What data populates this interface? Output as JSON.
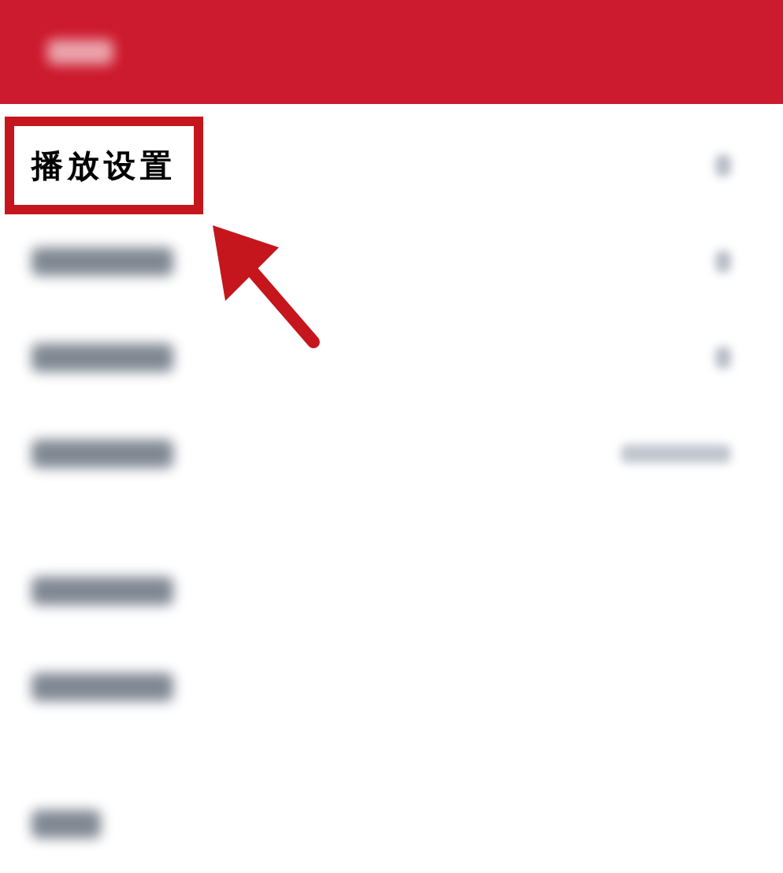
{
  "header": {
    "title_blurred": true
  },
  "groups": [
    {
      "items": [
        {
          "kind": "text",
          "label": "播放设置",
          "highlighted": true,
          "chevron": true,
          "value_blurred": false
        },
        {
          "kind": "blurred",
          "highlighted": false,
          "chevron": true,
          "value_blurred": false
        },
        {
          "kind": "blurred",
          "highlighted": false,
          "chevron": true,
          "value_blurred": false
        },
        {
          "kind": "blurred",
          "highlighted": false,
          "chevron": false,
          "value_blurred": true
        }
      ]
    },
    {
      "items": [
        {
          "kind": "blurred",
          "highlighted": false,
          "chevron": false,
          "value_blurred": false
        },
        {
          "kind": "blurred",
          "highlighted": false,
          "chevron": false,
          "value_blurred": false
        }
      ]
    },
    {
      "items": [
        {
          "kind": "blurred-short",
          "highlighted": false,
          "chevron": false,
          "value_blurred": false
        }
      ]
    }
  ]
}
